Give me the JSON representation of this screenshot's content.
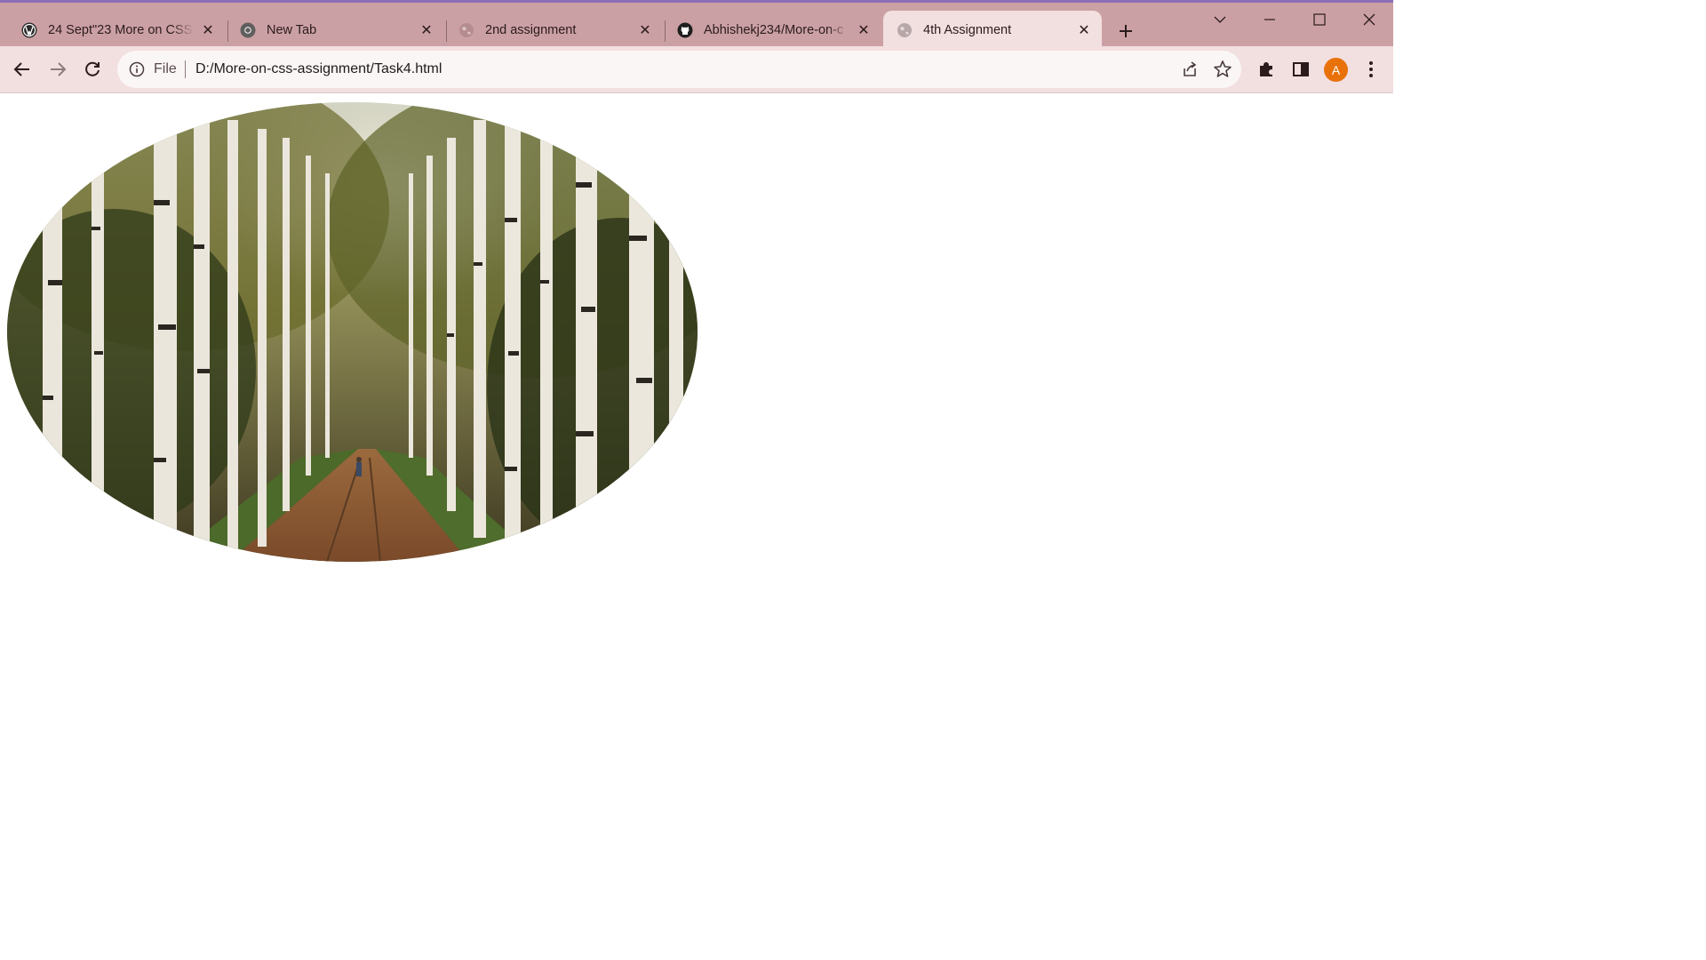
{
  "tabs": [
    {
      "title": "24 Sept\"23 More on CSS",
      "icon": "wordpress-icon",
      "active": false
    },
    {
      "title": "New Tab",
      "icon": "chrome-icon",
      "active": false
    },
    {
      "title": "2nd assignment",
      "icon": "globe-icon",
      "active": false
    },
    {
      "title": "Abhishekj234/More-on-c",
      "icon": "github-icon",
      "active": false
    },
    {
      "title": "4th Assignment",
      "icon": "globe-icon",
      "active": true
    }
  ],
  "omnibox": {
    "scheme_label": "File",
    "url": "D:/More-on-css-assignment/Task4.html"
  },
  "profile": {
    "initial": "A",
    "color": "#e8710a"
  },
  "colors": {
    "titlebar": "#cba0a4",
    "toolbar": "#f2dfe0",
    "accent": "#8c6fb8"
  },
  "page": {
    "image_subject": "birch forest path"
  }
}
